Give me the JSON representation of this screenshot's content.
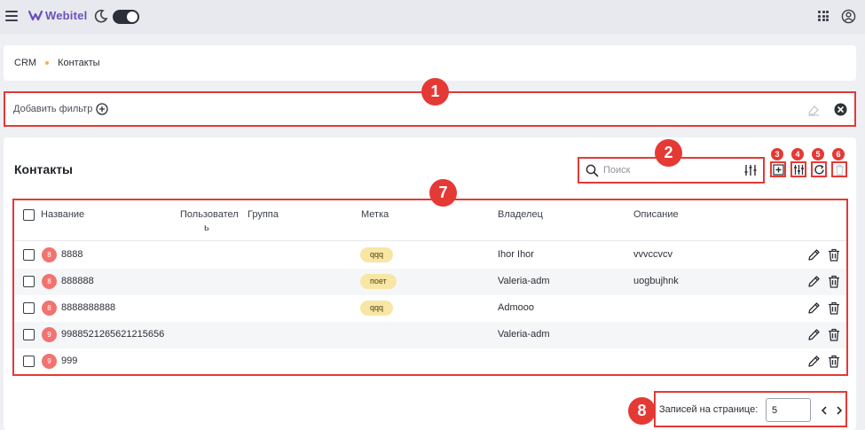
{
  "app": {
    "name": "Webitel"
  },
  "breadcrumb": {
    "root": "CRM",
    "current": "Контакты"
  },
  "filters": {
    "add_label": "Добавить фильтр"
  },
  "page": {
    "title": "Контакты"
  },
  "search": {
    "placeholder": "Поиск",
    "value": ""
  },
  "table": {
    "headers": {
      "name": "Название",
      "user_line1": "Пользовател",
      "user_line2": "ь",
      "group": "Группа",
      "label": "Метка",
      "owner": "Владелец",
      "description": "Описание"
    },
    "rows": [
      {
        "avatar": "8",
        "name": "8888",
        "label": "qqq",
        "owner": "Ihor Ihor",
        "description": "vvvccvcv"
      },
      {
        "avatar": "8",
        "name": "888888",
        "label": "поет",
        "owner": "Valeria-adm",
        "description": "uogbujhnk"
      },
      {
        "avatar": "8",
        "name": "8888888888",
        "label": "qqq",
        "owner": "Admooo",
        "description": ""
      },
      {
        "avatar": "9",
        "name": "9988521265621215656",
        "label": "",
        "owner": "Valeria-adm",
        "description": ""
      },
      {
        "avatar": "9",
        "name": "999",
        "label": "",
        "owner": "",
        "description": ""
      }
    ]
  },
  "pagination": {
    "label": "Записей на странице:",
    "per_page": "5"
  },
  "callouts": {
    "c1": "1",
    "c2": "2",
    "c3": "3",
    "c4": "4",
    "c5": "5",
    "c6": "6",
    "c7": "7",
    "c8": "8"
  },
  "colors": {
    "accent": "#e53935",
    "brand": "#6b4fbb",
    "avatar": "#f1736f",
    "tag": "#f8e6a4"
  },
  "icons": [
    "menu-icon",
    "logo-mark-icon",
    "moon-icon",
    "apps-grid-icon",
    "account-icon",
    "plus-circle-icon",
    "eraser-icon",
    "close-circle-icon",
    "search-icon",
    "filter-settings-icon",
    "add-icon",
    "columns-icon",
    "refresh-icon",
    "delete-icon",
    "edit-icon",
    "trash-icon",
    "chevron-left-icon",
    "chevron-right-icon"
  ]
}
